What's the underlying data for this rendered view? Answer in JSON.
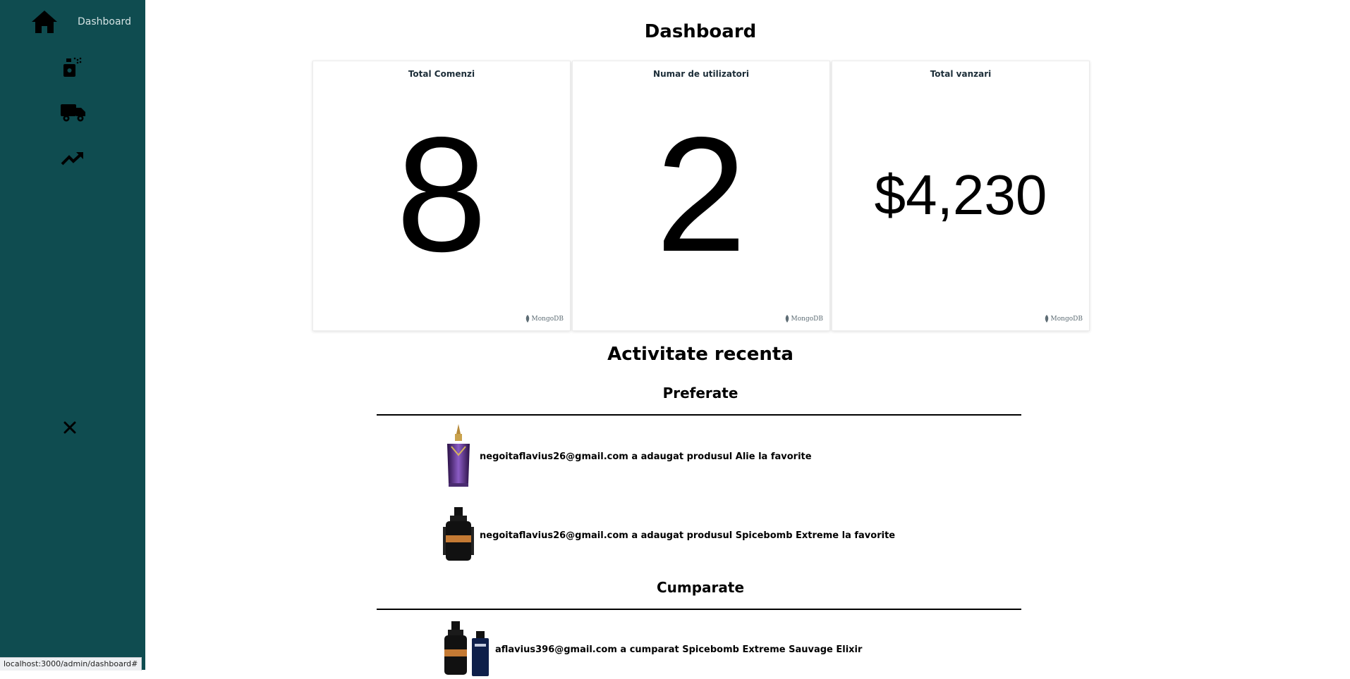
{
  "sidebar": {
    "items": [
      {
        "name": "dashboard",
        "label": "Dashboard",
        "icon": "home-icon"
      },
      {
        "name": "products",
        "icon": "perfume-spray-icon"
      },
      {
        "name": "orders",
        "icon": "truck-icon"
      },
      {
        "name": "sales",
        "icon": "trending-up-icon"
      }
    ],
    "close_icon": "close-icon"
  },
  "status_bar": {
    "url": "localhost:3000/admin/dashboard#"
  },
  "main": {
    "title": "Dashboard",
    "cards": [
      {
        "title": "Total Comenzi",
        "value": "8",
        "brand": "MongoDB"
      },
      {
        "title": "Numar de utilizatori",
        "value": "2",
        "brand": "MongoDB"
      },
      {
        "title": "Total vanzari",
        "value": "$4,230",
        "brand": "MongoDB"
      }
    ],
    "activity": {
      "title": "Activitate recenta",
      "favorites": {
        "title": "Preferate",
        "items": [
          {
            "text": "negoitaflavius26@gmail.com a adaugat produsul Alie la favorite",
            "product": "Alie"
          },
          {
            "text": "negoitaflavius26@gmail.com a adaugat produsul Spicebomb Extreme la favorite",
            "product": "Spicebomb Extreme"
          }
        ]
      },
      "purchases": {
        "title": "Cumparate",
        "items": [
          {
            "text": "aflavius396@gmail.com a cumparat Spicebomb Extreme Sauvage Elixir",
            "products": [
              "Spicebomb Extreme",
              "Sauvage Elixir"
            ]
          }
        ]
      }
    }
  },
  "colors": {
    "sidebar_bg": "#0f4c50",
    "text": "#000000",
    "card_border": "#ececec"
  }
}
